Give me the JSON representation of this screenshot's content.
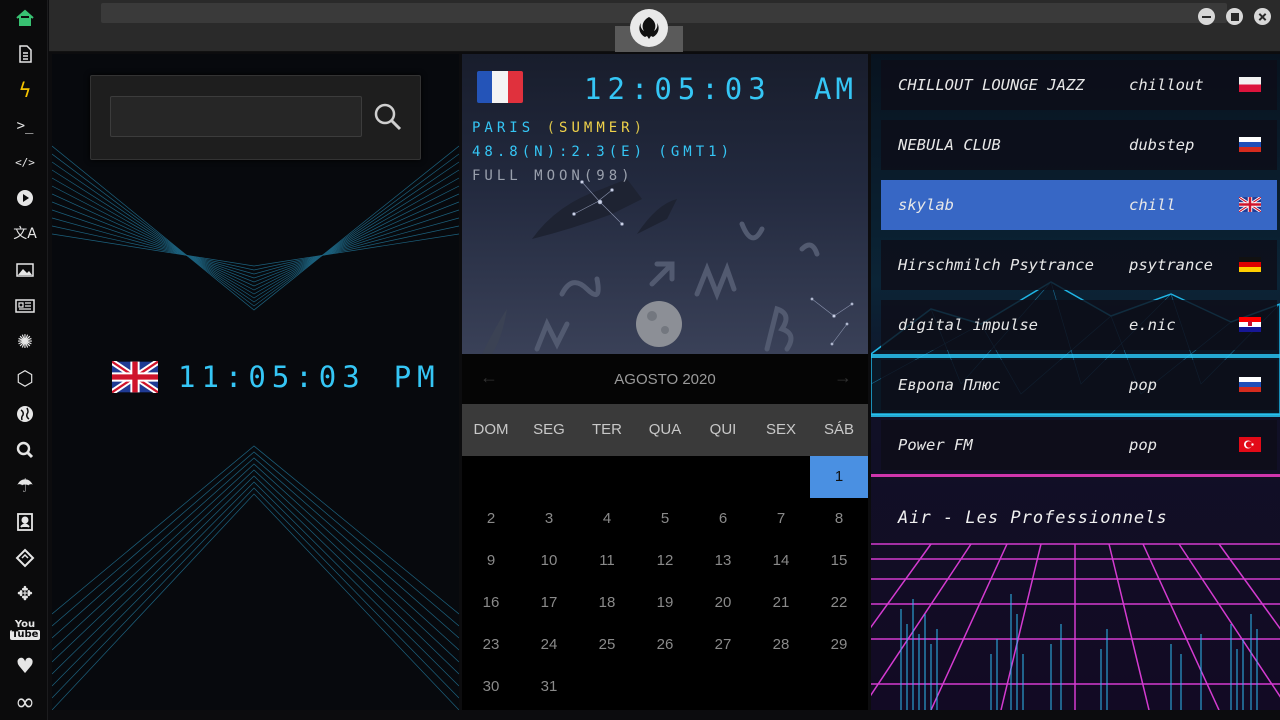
{
  "sidebar": {
    "items": [
      {
        "name": "home-icon",
        "glyph": "⌂"
      },
      {
        "name": "document-icon",
        "glyph": "▤"
      },
      {
        "name": "lightning-icon",
        "glyph": "ϟ"
      },
      {
        "name": "terminal-icon",
        "glyph": ">_"
      },
      {
        "name": "code-icon",
        "glyph": "</>"
      },
      {
        "name": "play-icon",
        "glyph": "▶"
      },
      {
        "name": "translate-icon",
        "glyph": "A"
      },
      {
        "name": "image-icon",
        "glyph": "▨"
      },
      {
        "name": "newspaper-icon",
        "glyph": "▦"
      },
      {
        "name": "rebel-icon",
        "glyph": "✺"
      },
      {
        "name": "hexagon-icon",
        "glyph": "⬡"
      },
      {
        "name": "globe-icon",
        "glyph": "●"
      },
      {
        "name": "search-icon",
        "glyph": "⌕"
      },
      {
        "name": "umbrella-icon",
        "glyph": "☂"
      },
      {
        "name": "contacts-icon",
        "glyph": "▣"
      },
      {
        "name": "tag-icon",
        "glyph": "◈"
      },
      {
        "name": "expand-icon",
        "glyph": "✥"
      },
      {
        "name": "youtube-icon",
        "glyph": "▶"
      },
      {
        "name": "heart-icon",
        "glyph": "♥"
      },
      {
        "name": "infinity-icon",
        "glyph": "∞"
      }
    ]
  },
  "search": {
    "value": "",
    "placeholder": ""
  },
  "clock_uk": {
    "time": "11:05:03",
    "ampm": "PM"
  },
  "clock_fr": {
    "time": "12:05:03",
    "ampm": "AM",
    "city": "PARIS",
    "season": "SUMMER",
    "coords": "48.8(N):2.3(E) (GMT1)",
    "moon": "FULL MOON(98)"
  },
  "calendar": {
    "month_label": "AGOSTO 2020",
    "weekdays": [
      "DOM",
      "SEG",
      "TER",
      "QUA",
      "QUI",
      "SEX",
      "SÁB"
    ],
    "weeks": [
      [
        "",
        "",
        "",
        "",
        "",
        "",
        "1"
      ],
      [
        "2",
        "3",
        "4",
        "5",
        "6",
        "7",
        "8"
      ],
      [
        "9",
        "10",
        "11",
        "12",
        "13",
        "14",
        "15"
      ],
      [
        "16",
        "17",
        "18",
        "19",
        "20",
        "21",
        "22"
      ],
      [
        "23",
        "24",
        "25",
        "26",
        "27",
        "28",
        "29"
      ],
      [
        "30",
        "31",
        "",
        "",
        "",
        "",
        ""
      ]
    ],
    "selected": "1"
  },
  "radio": {
    "stations": [
      {
        "name": "CHILLOUT LOUNGE JAZZ",
        "genre": "chillout",
        "flag": "pl"
      },
      {
        "name": "NEBULA CLUB",
        "genre": "dubstep",
        "flag": "ru"
      },
      {
        "name": "skylab",
        "genre": "chill",
        "flag": "uk",
        "active": true
      },
      {
        "name": "Hirschmilch Psytrance",
        "genre": "psytrance",
        "flag": "de"
      },
      {
        "name": "digital impulse",
        "genre": "e.nic",
        "flag": "hr"
      },
      {
        "name": "Европа Плюс",
        "genre": "pop",
        "flag": "ru"
      },
      {
        "name": "Power FM",
        "genre": "pop",
        "flag": "tr"
      }
    ],
    "now_playing": "Air - Les Professionnels"
  },
  "colors": {
    "accent": "#35c6f5",
    "selected_day": "#4a90e2",
    "active_station": "#3c6ed2"
  }
}
